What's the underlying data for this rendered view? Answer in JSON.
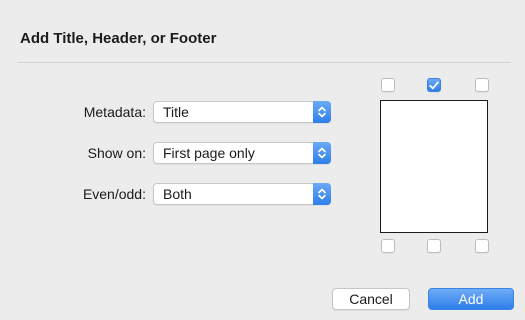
{
  "dialog": {
    "title": "Add Title, Header, or Footer"
  },
  "fields": [
    {
      "label": "Metadata:",
      "value": "Title"
    },
    {
      "label": "Show on:",
      "value": "First page only"
    },
    {
      "label": "Even/odd:",
      "value": "Both"
    }
  ],
  "placement": {
    "top_checkboxes": [
      {
        "name": "top-left",
        "checked": false
      },
      {
        "name": "top-center",
        "checked": true
      },
      {
        "name": "top-right",
        "checked": false
      }
    ],
    "bottom_checkboxes": [
      {
        "name": "bottom-left",
        "checked": false
      },
      {
        "name": "bottom-center",
        "checked": false
      },
      {
        "name": "bottom-right",
        "checked": false
      }
    ]
  },
  "buttons": {
    "cancel_label": "Cancel",
    "add_label": "Add"
  },
  "colors": {
    "accent": "#2f7fe8",
    "background": "#ececec"
  },
  "icons": {
    "popup_arrows": "up-down-chevron-icon",
    "check": "checkmark-icon"
  }
}
